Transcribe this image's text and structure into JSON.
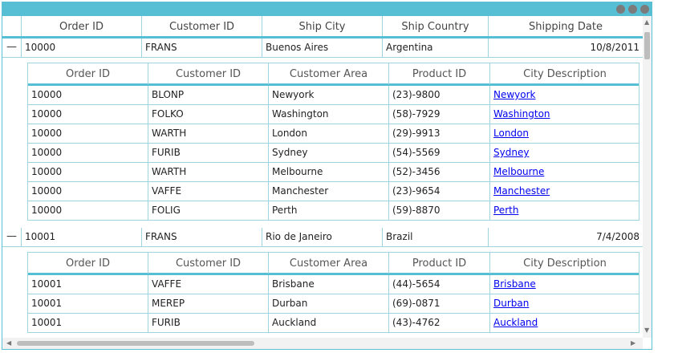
{
  "columns": [
    "Order ID",
    "Customer ID",
    "Ship City",
    "Ship Country",
    "Shipping Date"
  ],
  "detail_columns": [
    "Order ID",
    "Customer ID",
    "Customer Area",
    "Product ID",
    "City Description"
  ],
  "orders": [
    {
      "toggle": "—",
      "order_id": "10000",
      "customer_id": "FRANS",
      "ship_city": "Buenos Aires",
      "ship_country": "Argentina",
      "shipping_date": "10/8/2011",
      "details": [
        {
          "order_id": "10000",
          "customer_id": "BLONP",
          "area": "Newyork",
          "product_id": "(23)-9800",
          "city_desc": "Newyork"
        },
        {
          "order_id": "10000",
          "customer_id": "FOLKO",
          "area": "Washington",
          "product_id": "(58)-7929",
          "city_desc": "Washington"
        },
        {
          "order_id": "10000",
          "customer_id": "WARTH",
          "area": "London",
          "product_id": "(29)-9913",
          "city_desc": "London"
        },
        {
          "order_id": "10000",
          "customer_id": "FURIB",
          "area": "Sydney",
          "product_id": "(54)-5569",
          "city_desc": "Sydney"
        },
        {
          "order_id": "10000",
          "customer_id": "WARTH",
          "area": "Melbourne",
          "product_id": "(52)-3456",
          "city_desc": "Melbourne"
        },
        {
          "order_id": "10000",
          "customer_id": "VAFFE",
          "area": "Manchester",
          "product_id": "(23)-9654",
          "city_desc": "Manchester"
        },
        {
          "order_id": "10000",
          "customer_id": "FOLIG",
          "area": "Perth",
          "product_id": "(59)-8870",
          "city_desc": "Perth"
        }
      ]
    },
    {
      "toggle": "—",
      "order_id": "10001",
      "customer_id": "FRANS",
      "ship_city": "Rio de Janeiro",
      "ship_country": "Brazil",
      "shipping_date": "7/4/2008",
      "details": [
        {
          "order_id": "10001",
          "customer_id": "VAFFE",
          "area": "Brisbane",
          "product_id": "(44)-5654",
          "city_desc": "Brisbane"
        },
        {
          "order_id": "10001",
          "customer_id": "MEREP",
          "area": "Durban",
          "product_id": "(69)-0871",
          "city_desc": "Durban"
        },
        {
          "order_id": "10001",
          "customer_id": "FURIB",
          "area": "Auckland",
          "product_id": "(43)-4762",
          "city_desc": "Auckland"
        }
      ]
    }
  ]
}
